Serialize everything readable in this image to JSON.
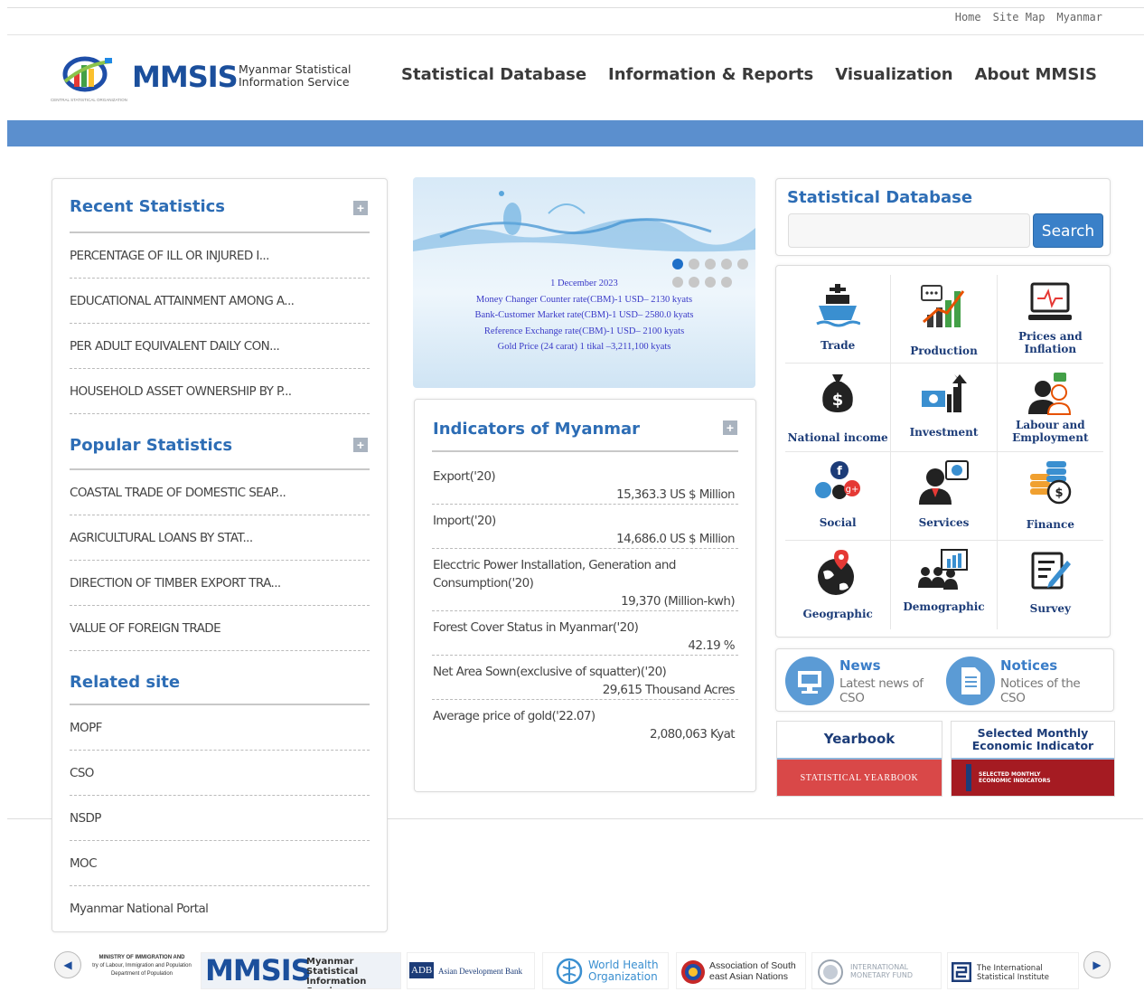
{
  "top_links": [
    "Home",
    "Site Map",
    "Myanmar"
  ],
  "logo": {
    "brand": "MMSIS",
    "tagline_1": "Myanmar Statistical",
    "tagline_2": "Information Service",
    "emblem_text": "CENTRAL STATISTICAL ORGANIZATION"
  },
  "nav": [
    "Statistical Database",
    "Information & Reports",
    "Visualization",
    "About MMSIS"
  ],
  "recent": {
    "title": "Recent Statistics",
    "items": [
      "PERCENTAGE OF ILL OR INJURED I...",
      "EDUCATIONAL ATTAINMENT AMONG A...",
      "PER ADULT EQUIVALENT DAILY CON...",
      "HOUSEHOLD ASSET OWNERSHIP BY P..."
    ]
  },
  "popular": {
    "title": "Popular Statistics",
    "items": [
      "COASTAL TRADE OF DOMESTIC SEAP...",
      "AGRICULTURAL LOANS BY STAT...",
      "DIRECTION OF TIMBER EXPORT TRA...",
      "VALUE OF FOREIGN TRADE"
    ]
  },
  "related": {
    "title": "Related site",
    "items": [
      "MOPF",
      "CSO",
      "NSDP",
      "MOC",
      "Myanmar National Portal"
    ]
  },
  "slider": {
    "lines": [
      "1 December 2023",
      "Money Changer Counter rate(CBM)-1 USD– 2130 kyats",
      "Bank-Customer Market rate(CBM)-1 USD– 2580.0 kyats",
      "Reference Exchange rate(CBM)-1 USD– 2100 kyats",
      "Gold Price (24 carat) 1 tikal –3,211,100 kyats"
    ]
  },
  "indicators": {
    "title": "Indicators of Myanmar",
    "items": [
      {
        "label": "Export('20)",
        "value": "15,363.3 US $ Million"
      },
      {
        "label": "Import('20)",
        "value": "14,686.0 US $ Million"
      },
      {
        "label": "Elecctric Power Installation, Generation and Consumption('20)",
        "value": "19,370 (Million-kwh)"
      },
      {
        "label": "Forest Cover Status in Myanmar('20)",
        "value": "42.19 %"
      },
      {
        "label": "Net Area Sown(exclusive of squatter)('20)",
        "value": "29,615 Thousand Acres"
      },
      {
        "label": "Average price of gold('22.07)",
        "value": "2,080,063 Kyat"
      }
    ]
  },
  "search": {
    "title": "Statistical Database",
    "button": "Search",
    "placeholder": ""
  },
  "categories": [
    {
      "label": "Trade",
      "icon": "ship-icon"
    },
    {
      "label": "Production",
      "icon": "production-chart-icon"
    },
    {
      "label": "Prices and Inflation",
      "icon": "monitor-pulse-icon"
    },
    {
      "label": "National income",
      "icon": "money-bag-icon"
    },
    {
      "label": "Investment",
      "icon": "investment-icon"
    },
    {
      "label": "Labour and Employment",
      "icon": "workers-icon"
    },
    {
      "label": "Social",
      "icon": "social-media-icon"
    },
    {
      "label": "Services",
      "icon": "service-agent-icon"
    },
    {
      "label": "Finance",
      "icon": "coins-icon"
    },
    {
      "label": "Geographic",
      "icon": "globe-pin-icon"
    },
    {
      "label": "Demographic",
      "icon": "people-board-icon"
    },
    {
      "label": "Survey",
      "icon": "survey-edit-icon"
    }
  ],
  "news": {
    "title": "News",
    "subtitle": "Latest news of CSO"
  },
  "notices": {
    "title": "Notices",
    "subtitle": "Notices of the CSO"
  },
  "yearbook": {
    "title": "Yearbook",
    "image_text": "STATISTICAL YEARBOOK"
  },
  "monthly": {
    "title": "Selected Monthly Economic Indicator",
    "image_text_1": "SELECTED MONTHLY",
    "image_text_2": "ECONOMIC INDICATORS"
  },
  "partners": [
    {
      "line1": "MINISTRY OF IMMIGRATION AND",
      "line2": "try of Labour, Immigration and Population",
      "line3": "Department of Population"
    },
    {
      "brand": "MMSIS",
      "line1": "Myanmar Statistical",
      "line2": "Information Service"
    },
    {
      "brand": "ADB",
      "line1": "Asian Development Bank"
    },
    {
      "line1": "World Health",
      "line2": "Organization"
    },
    {
      "line1": "Association of South",
      "line2": "east Asian Nations"
    },
    {
      "line1": "INTERNATIONAL",
      "line2": "MONETARY FUND"
    },
    {
      "line1": "The International",
      "line2": "Statistical Institute"
    }
  ],
  "colors": {
    "accent": "#2d6db5",
    "banner": "#5b8fce",
    "button": "#3a80c8",
    "navy": "#1c3c78",
    "red": "#d94848"
  }
}
